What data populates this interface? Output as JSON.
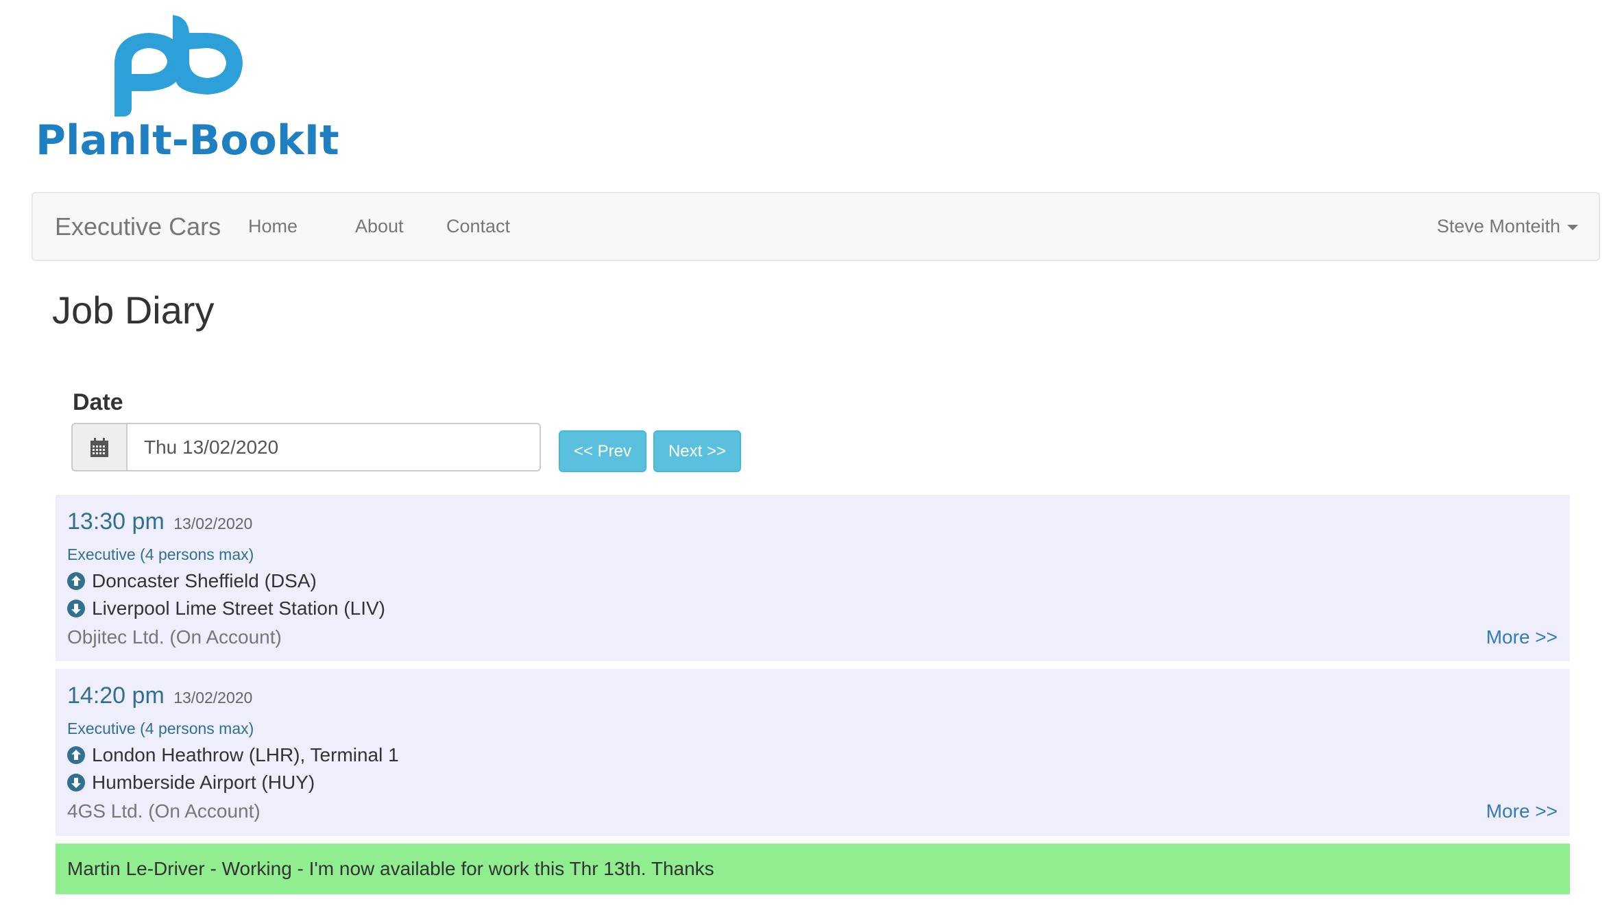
{
  "logo": {
    "monogram": "pb",
    "text": "PlanIt-BookIt",
    "colors": {
      "monogram": "#2d9fd9",
      "text": "#1e7fc2"
    }
  },
  "navbar": {
    "brand": "Executive Cars",
    "links": [
      "Home",
      "About",
      "Contact"
    ],
    "user": "Steve Monteith"
  },
  "page": {
    "title": "Job Diary"
  },
  "date_picker": {
    "label": "Date",
    "icon": "calendar-icon",
    "value": "Thu 13/02/2020",
    "prev_label": "<< Prev",
    "next_label": "Next >>"
  },
  "jobs": [
    {
      "time": "13:30 pm",
      "date": "13/02/2020",
      "vehicle": "Executive (4 persons max)",
      "pickup": "Doncaster Sheffield (DSA)",
      "dropoff": "Liverpool Lime Street Station (LIV)",
      "account": "Objitec Ltd. (On Account)",
      "more_label": "More >>"
    },
    {
      "time": "14:20 pm",
      "date": "13/02/2020",
      "vehicle": "Executive (4 persons max)",
      "pickup": "London Heathrow (LHR), Terminal 1",
      "dropoff": "Humberside Airport (HUY)",
      "account": "4GS Ltd. (On Account)",
      "more_label": "More >>"
    }
  ],
  "notice": {
    "text": "Martin Le-Driver - Working - I'm now available for work this Thr 13th. Thanks",
    "color": "#90ee90"
  },
  "colors": {
    "card_bg": "#eeeefc",
    "accent_info": "#5bc0de",
    "time_text": "#31708f",
    "link": "#337ab7"
  }
}
